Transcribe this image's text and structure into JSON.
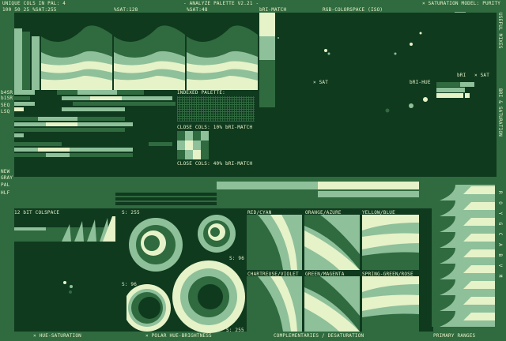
{
  "header": {
    "unique_cols": "UNIQUE COLS IN PAL: 4",
    "pct": "100 50 25 %SAT:255",
    "sat128": "%SAT:128",
    "sat48": "%SAT:48",
    "title": "- ANALYZE PALETTE V2.21 -",
    "colorspace": "RGB-COLORSPACE (ISO)",
    "sat_model": "× SATURATION MODEL: PURITY",
    "bri_match": "bRI-MATCH"
  },
  "left_labels": {
    "b4sr": "b4SR",
    "b1sr": "b1SR",
    "seq": "SEQ",
    "lsq": "LSQ",
    "new": "NEW",
    "gray": "GRAY",
    "pal": "PAL",
    "hlf": "HLF"
  },
  "indexed": {
    "title": "INDEXED PALETTE:",
    "close1": "CLOSE COLS: 10% bRI-MATCH",
    "close2": "CLOSE COLS: 40% bRI-MATCH"
  },
  "scatter": {
    "x_sat": "× SAT",
    "bri_hue": "bRI-HUE",
    "bri": "bRI",
    "x_sat2": "× SAT"
  },
  "right_vertical": {
    "useful": "USEFUL MIXES",
    "bri_sat": "BRI & SATURATION",
    "roygcabvm": "R O Y G C A B V M"
  },
  "colspace": {
    "title": "12 bIT COLSPACE",
    "s255": "S: 255",
    "s96a": "S: 96",
    "s96b": "S: 96",
    "s255b": "S: 255"
  },
  "comps": {
    "red_cyan": "RED/CYAN",
    "orange_azure": "ORANGE/AZURE",
    "yellow_blue": "YELLOW/BLUE",
    "chartreuse_violet": "CHARTREUSE/VIOLET",
    "green_magenta": "GREEN/MAGENTA",
    "spring_rose": "SPRING-GREEN/ROSE"
  },
  "footer": {
    "hue_sat": "× HUE-SATURATION",
    "polar": "× POLAR HUE-BRIGHTNESS",
    "comp_desat": "COMPLEMENTARIES / DESATURATION",
    "primary": "PRIMARY RANGES"
  },
  "palette": {
    "c0": "#0f3a1e",
    "c1": "#306a3f",
    "c2": "#8ec09a",
    "c3": "#e6f2c8"
  }
}
